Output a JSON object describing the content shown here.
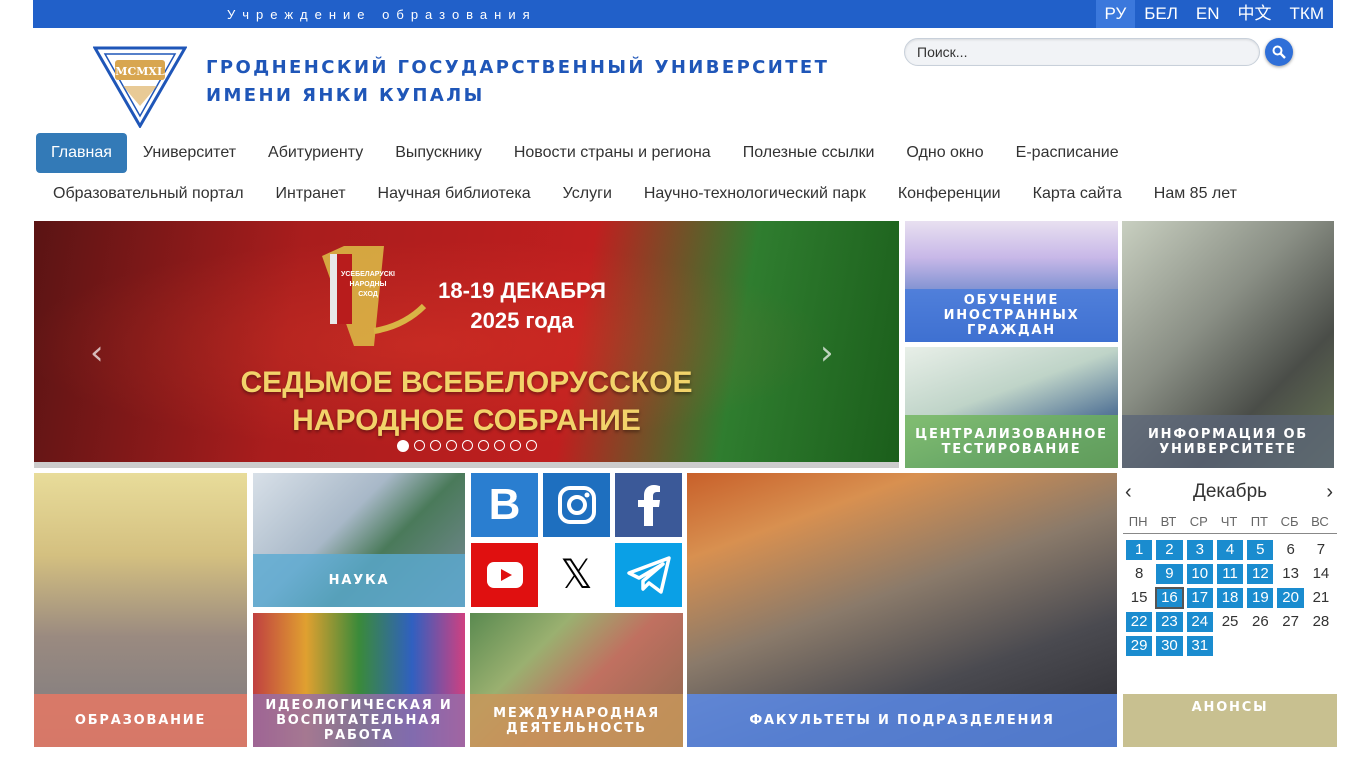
{
  "topbar": {
    "institution": "Учреждение образования",
    "languages": [
      "РУ",
      "БЕЛ",
      "EN",
      "中文",
      "ТКМ"
    ]
  },
  "header": {
    "title_line1": "ГРОДНЕНСКИЙ ГОСУДАРСТВЕННЫЙ УНИВЕРСИТЕТ",
    "title_line2": "ИМЕНИ ЯНКИ КУПАЛЫ",
    "logo_text": "MCMXL",
    "search_placeholder": "Поиск..."
  },
  "nav_row1": [
    "Главная",
    "Университет",
    "Абитуриенту",
    "Выпускнику",
    "Новости страны и региона",
    "Полезные ссылки",
    "Одно окно",
    "Е-расписание"
  ],
  "nav_row2": [
    "Образовательный портал",
    "Интранет",
    "Научная библиотека",
    "Услуги",
    "Научно-технологический парк",
    "Конференции",
    "Карта сайта",
    "Нам 85 лет"
  ],
  "slider": {
    "emblem_text": "УСЕБЕЛАРУСКІ НАРОДНЫ СХОД",
    "date_line1": "18-19 ДЕКАБРЯ",
    "date_line2": "2025 года",
    "headline1": "СЕДЬМОЕ ВСЕБЕЛОРУССКОЕ",
    "headline2": "НАРОДНОЕ СОБРАНИЕ",
    "prev": "‹",
    "next": "›",
    "dot_count": 9,
    "active_dot": 1
  },
  "tiles": {
    "foreign": "ОБУЧЕНИЕ ИНОСТРАННЫХ ГРАЖДАН",
    "testing": "ЦЕНТРАЛИЗОВАННОЕ ТЕСТИРОВАНИЕ",
    "info": "ИНФОРМАЦИЯ ОБ УНИВЕРСИТЕТЕ",
    "education": "ОБРАЗОВАНИЕ",
    "science": "НАУКА",
    "ideology": "ИДЕОЛОГИЧЕСКАЯ И ВОСПИТАТЕЛЬНАЯ РАБОТА",
    "international": "МЕЖДУНАРОДНАЯ ДЕЯТЕЛЬНОСТЬ",
    "faculties": "ФАКУЛЬТЕТЫ И ПОДРАЗДЕЛЕНИЯ",
    "announcements": "АНОНСЫ"
  },
  "social": {
    "vk_letter": "В",
    "x_letter": "𝕏",
    "colors": {
      "vk": "#2a7ed0",
      "instagram": "#1e6fbf",
      "facebook": "#3b5998",
      "youtube": "#e01010",
      "x": "#ffffff",
      "telegram": "#0aa0e6"
    }
  },
  "calendar": {
    "month": "Декабрь",
    "weekdays": [
      "ПН",
      "ВТ",
      "СР",
      "ЧТ",
      "ПТ",
      "СБ",
      "ВС"
    ],
    "days": [
      1,
      2,
      3,
      4,
      5,
      6,
      7,
      8,
      9,
      10,
      11,
      12,
      13,
      14,
      15,
      16,
      17,
      18,
      19,
      20,
      21,
      22,
      23,
      24,
      25,
      26,
      27,
      28,
      29,
      30,
      31
    ],
    "event_days": [
      1,
      2,
      3,
      4,
      5,
      9,
      10,
      11,
      12,
      16,
      17,
      18,
      19,
      20,
      22,
      23,
      24,
      29,
      30,
      31
    ],
    "today": 16
  }
}
